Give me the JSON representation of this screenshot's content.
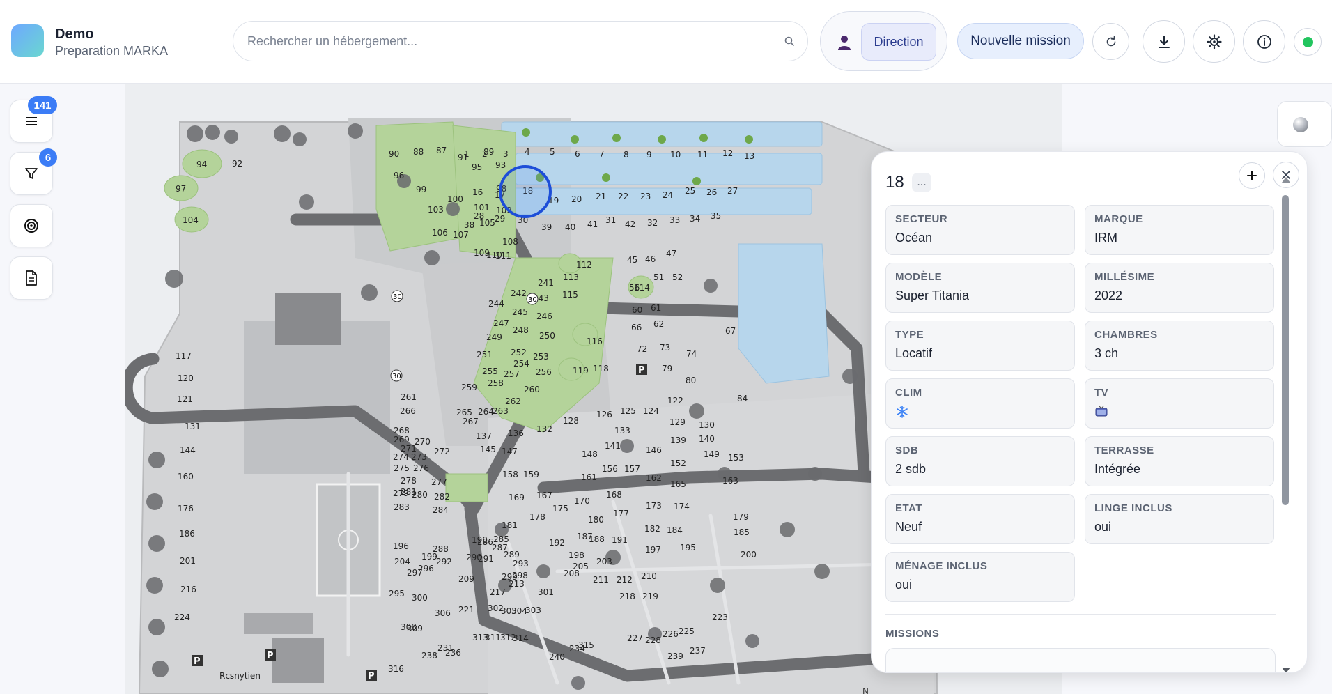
{
  "app": {
    "name": "Demo",
    "subtitle": "Preparation MARKA"
  },
  "search": {
    "placeholder": "Rechercher un hébergement..."
  },
  "header": {
    "role_label": "Direction",
    "new_mission_label": "Nouvelle mission",
    "icons": [
      "user-icon",
      "refresh-icon",
      "download-icon",
      "settings-icon",
      "info-icon",
      "status-online-dot"
    ],
    "status_color": "#22c55e"
  },
  "rail": {
    "list_badge": "141",
    "filter_badge": "6",
    "items": [
      "list-icon",
      "filter-icon",
      "target-icon",
      "document-icon"
    ]
  },
  "map": {
    "selected_lot": "18",
    "lots_top_row": [
      "1",
      "2",
      "3",
      "4",
      "5",
      "6",
      "7",
      "8",
      "9",
      "10",
      "11",
      "12",
      "13"
    ],
    "lots_second_row": [
      "16",
      "17",
      "18",
      "19",
      "20",
      "21",
      "22",
      "23",
      "24",
      "25",
      "26",
      "27"
    ],
    "lots_third_row": [
      "38",
      "28",
      "29",
      "30",
      "39",
      "40",
      "41",
      "31",
      "42",
      "32",
      "33",
      "34",
      "35"
    ],
    "lots_west": [
      "94",
      "92",
      "97",
      "104",
      "117",
      "120",
      "121",
      "131",
      "144",
      "160",
      "176",
      "186",
      "201",
      "216",
      "224"
    ],
    "lots_north": [
      "90",
      "88",
      "87",
      "91",
      "89",
      "95",
      "93",
      "96",
      "99",
      "98",
      "100",
      "101",
      "102",
      "103",
      "106",
      "107",
      "105",
      "108",
      "109",
      "110",
      "111"
    ],
    "lots_center": [
      "112",
      "113",
      "114",
      "115",
      "116",
      "118",
      "119",
      "241",
      "242",
      "243",
      "244",
      "245",
      "246",
      "247",
      "248",
      "249",
      "250",
      "251",
      "252",
      "253",
      "254",
      "255",
      "256",
      "257",
      "258",
      "259",
      "260",
      "261",
      "262",
      "263",
      "264",
      "265",
      "266",
      "267"
    ],
    "lots_south": [
      "122",
      "124",
      "125",
      "126",
      "128",
      "129",
      "130",
      "132",
      "133",
      "136",
      "137",
      "139",
      "140",
      "141",
      "145",
      "146",
      "147",
      "148",
      "149",
      "152",
      "153",
      "156",
      "157",
      "158",
      "159",
      "161",
      "162",
      "163",
      "165",
      "167",
      "168",
      "169",
      "170",
      "173",
      "174",
      "175",
      "177",
      "178",
      "179",
      "180",
      "181",
      "182",
      "184",
      "185",
      "187",
      "188",
      "190",
      "191",
      "192",
      "195",
      "196",
      "197",
      "198",
      "199",
      "200",
      "203",
      "204",
      "205",
      "208",
      "209",
      "210",
      "211",
      "212",
      "213",
      "217",
      "218",
      "219",
      "221",
      "223",
      "225",
      "226",
      "227",
      "228",
      "231",
      "234",
      "236",
      "237",
      "238",
      "239",
      "240"
    ],
    "lots_east": [
      "45",
      "46",
      "47",
      "51",
      "52",
      "56",
      "60",
      "61",
      "62",
      "66",
      "67",
      "72",
      "73",
      "74",
      "79",
      "80",
      "84"
    ],
    "lots_misc": [
      "268",
      "269",
      "270",
      "271",
      "272",
      "273",
      "274",
      "275",
      "276",
      "277",
      "278",
      "279",
      "280",
      "281",
      "282",
      "283",
      "284",
      "285",
      "286",
      "287",
      "288",
      "289",
      "290",
      "291",
      "292",
      "293",
      "295",
      "296",
      "297",
      "298",
      "299",
      "300",
      "301",
      "302",
      "303",
      "304",
      "305",
      "306",
      "308",
      "309",
      "311",
      "312",
      "313",
      "314",
      "315",
      "316"
    ],
    "road_markers": [
      "30",
      "30",
      "30"
    ],
    "place_name": "Rcsnytien",
    "parking_label": "P",
    "compass_label": "N"
  },
  "panel": {
    "title": "18",
    "more_label": "...",
    "fields": [
      {
        "label": "SECTEUR",
        "value": "Océan"
      },
      {
        "label": "MARQUE",
        "value": "IRM"
      },
      {
        "label": "MODÈLE",
        "value": "Super Titania"
      },
      {
        "label": "MILLÉSIME",
        "value": "2022"
      },
      {
        "label": "TYPE",
        "value": "Locatif"
      },
      {
        "label": "CHAMBRES",
        "value": "3 ch"
      },
      {
        "label": "CLIM",
        "icon": "snowflake-icon"
      },
      {
        "label": "TV",
        "icon": "tv-icon"
      },
      {
        "label": "SDB",
        "value": "2 sdb"
      },
      {
        "label": "TERRASSE",
        "value": "Intégrée"
      },
      {
        "label": "ETAT",
        "value": "Neuf"
      },
      {
        "label": "LINGE INCLUS",
        "value": "oui"
      },
      {
        "label": "MÉNAGE INCLUS",
        "value": "oui"
      }
    ],
    "missions_label": "MISSIONS"
  }
}
